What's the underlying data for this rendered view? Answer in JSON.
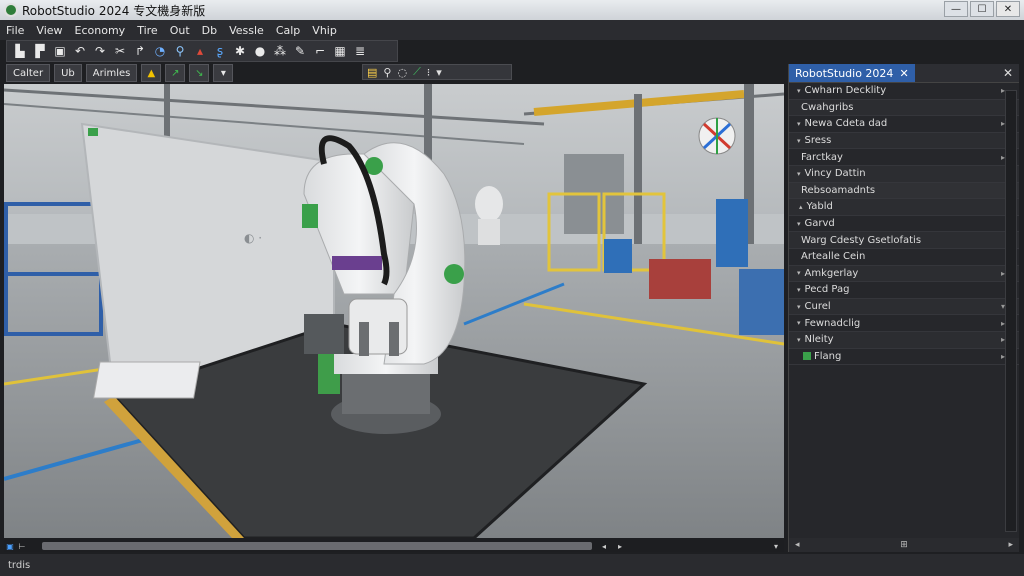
{
  "window": {
    "title": "RobotStudio 2024 专文機身新版",
    "min": "—",
    "max": "☐",
    "close": "✕"
  },
  "menu": [
    "File",
    "View",
    "Economy",
    "Tire",
    "Out",
    "Db",
    "Vessle",
    "Calp",
    "Vhip"
  ],
  "toolbar2": {
    "btn1": "Calter",
    "btn2": "Ub",
    "btn3": "Arimles"
  },
  "panel": {
    "tab_label": "RobotStudio 2024",
    "tab_close": "✕",
    "close": "✕",
    "rows": [
      {
        "label": "Cwharn Decklity",
        "arrow": "▾",
        "right": "▸"
      },
      {
        "label": "Cwahgribs",
        "arrow": "",
        "right": ""
      },
      {
        "label": "Newa Cdeta dad",
        "arrow": "▾",
        "right": "▸"
      },
      {
        "label": "Sress",
        "arrow": "▾",
        "right": ""
      },
      {
        "label": "Farctkay",
        "arrow": "",
        "right": "▸"
      },
      {
        "label": "Vincy Dattin",
        "arrow": "▾",
        "right": ""
      },
      {
        "label": "Rebsoamadnts",
        "arrow": "",
        "right": ""
      },
      {
        "label": "Yabld",
        "arrow": "▴",
        "right": ""
      },
      {
        "label": "Garvd",
        "arrow": "▾",
        "right": ""
      },
      {
        "label": "Warg Cdesty Gsetlofatis",
        "arrow": "",
        "right": ""
      },
      {
        "label": "Artealle Cein",
        "arrow": "",
        "right": ""
      },
      {
        "label": "Amkgerlay",
        "arrow": "▾",
        "right": "▸"
      },
      {
        "label": "Pecd Pag",
        "arrow": "▾",
        "right": ""
      },
      {
        "label": "Curel",
        "arrow": "▾",
        "right": "▾"
      },
      {
        "label": "Fewnadclig",
        "arrow": "▾",
        "right": "▸"
      },
      {
        "label": "Nleity",
        "arrow": "▾",
        "right": "▸"
      },
      {
        "label": "Flang",
        "arrow": "",
        "right": "▸"
      }
    ],
    "footer_center": "⊞"
  },
  "status": {
    "text": "trdis"
  }
}
